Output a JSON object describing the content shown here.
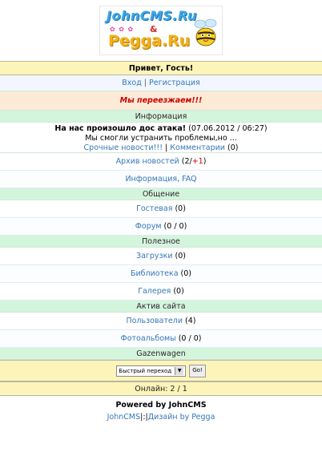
{
  "logo": {
    "line1": "JohnCMS.Ru",
    "amp": "&",
    "line2": "Pegga.Ru"
  },
  "greeting": "Привет, Гость!",
  "auth": {
    "login": "Вход",
    "sep": " | ",
    "register": "Регистрация"
  },
  "moving_notice": "Мы переезжаем!!!",
  "sections": {
    "info": "Информация",
    "community": "Общение",
    "useful": "Полезное",
    "activity": "Актив сайта",
    "gazenwagen": "Gazenwagen"
  },
  "news": {
    "title": "На нас произошло дос атака!",
    "date": "(07.06.2012 / 06:27)",
    "text": "Мы смогли устранить проблемы,но ...",
    "link1": "Срочные новости!!!",
    "sep": " | ",
    "link2": "Комментарии",
    "comments_count": "(0)"
  },
  "items": {
    "archive": {
      "label": "Архив новостей",
      "count_pre": "(2/",
      "count_new": "+1",
      "count_post": ")"
    },
    "faq": {
      "label": "Информация, FAQ"
    },
    "guestbook": {
      "label": "Гостевая",
      "count": "(0)"
    },
    "forum": {
      "label": "Форум",
      "count": "(0 / 0)"
    },
    "downloads": {
      "label": "Загрузки",
      "count": "(0)"
    },
    "library": {
      "label": "Библиотека",
      "count": "(0)"
    },
    "gallery": {
      "label": "Галерея",
      "count": "(0)"
    },
    "users": {
      "label": "Пользователи",
      "count": "(4)"
    },
    "albums": {
      "label": "Фотоальбомы",
      "count": "(0 / 0)"
    }
  },
  "quick_jump": {
    "selected": "Быстрый переход",
    "go": "Go!"
  },
  "online": "Онлайн: 2 / 1",
  "footer": {
    "powered": "Powered by JohnCMS",
    "johncms": "JohnCMS",
    "sep": "|:|",
    "design": "Дизайн by Pegga"
  },
  "colors": {
    "header_green": "#d3f5dc",
    "header_yellow": "#fdf4ba",
    "link": "#3677b8",
    "alert_red": "#cc0000"
  }
}
